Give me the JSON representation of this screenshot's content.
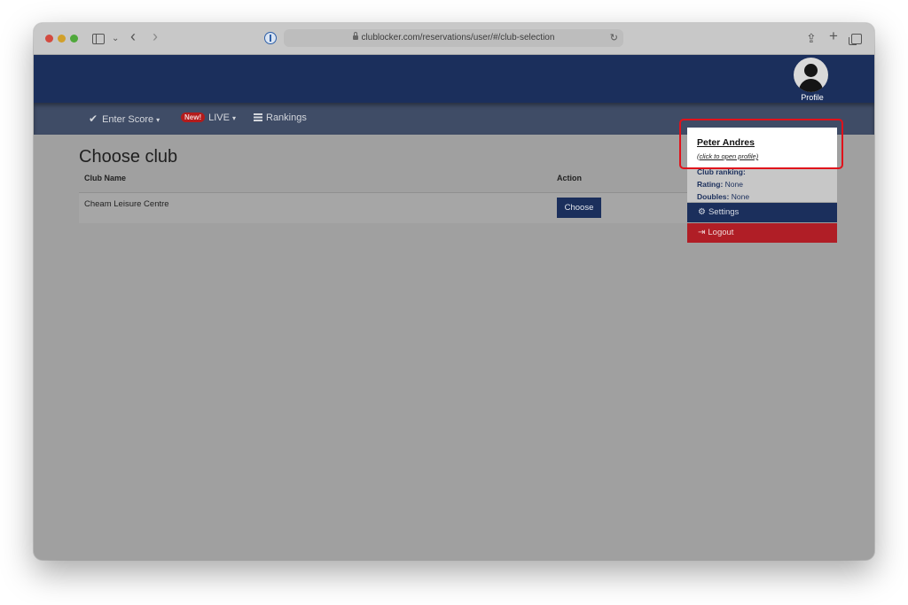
{
  "browser": {
    "url": "clublocker.com/reservations/user/#/club-selection",
    "icons": [
      "sidebar-icon",
      "chevron-down-icon",
      "back-icon",
      "forward-icon",
      "password-manager-icon",
      "lock-icon",
      "reload-icon",
      "share-icon",
      "plus-icon",
      "tabs-icon"
    ],
    "glyphs": {
      "back": "‹",
      "forward": "›",
      "caret": "⌄",
      "reload": "↻",
      "share": "⇪",
      "plus": "+"
    }
  },
  "header": {
    "profile_label": "Profile",
    "background": "#1b2f5c"
  },
  "navbar": {
    "items": [
      {
        "icon": "checkmark-icon",
        "glyph": "✔",
        "label": "Enter Score",
        "caret": "▾"
      },
      {
        "badge": "New!",
        "label": "LIVE",
        "caret": "▾"
      },
      {
        "icon": "list-icon",
        "label": "Rankings"
      }
    ]
  },
  "main": {
    "title": "Choose club",
    "table": {
      "columns": [
        "Club Name",
        "Action"
      ],
      "rows": [
        {
          "club_name": "Cheam Leisure Centre",
          "action_label": "Choose"
        }
      ]
    }
  },
  "profile_menu": {
    "name": "Peter Andres",
    "hint": "(click to open profile)",
    "club_ranking_label": "Club ranking:",
    "rating_label": "Rating:",
    "rating_value": "None",
    "doubles_label": "Doubles:",
    "doubles_value": "None",
    "settings": {
      "icon": "gear-icon",
      "glyph": "⚙",
      "label": "Settings"
    },
    "logout": {
      "icon": "logout-icon",
      "glyph": "⇥",
      "label": "Logout"
    }
  },
  "colors": {
    "highlight": "#e0121b",
    "logout": "#b01e26",
    "brand": "#1b2f5c"
  }
}
